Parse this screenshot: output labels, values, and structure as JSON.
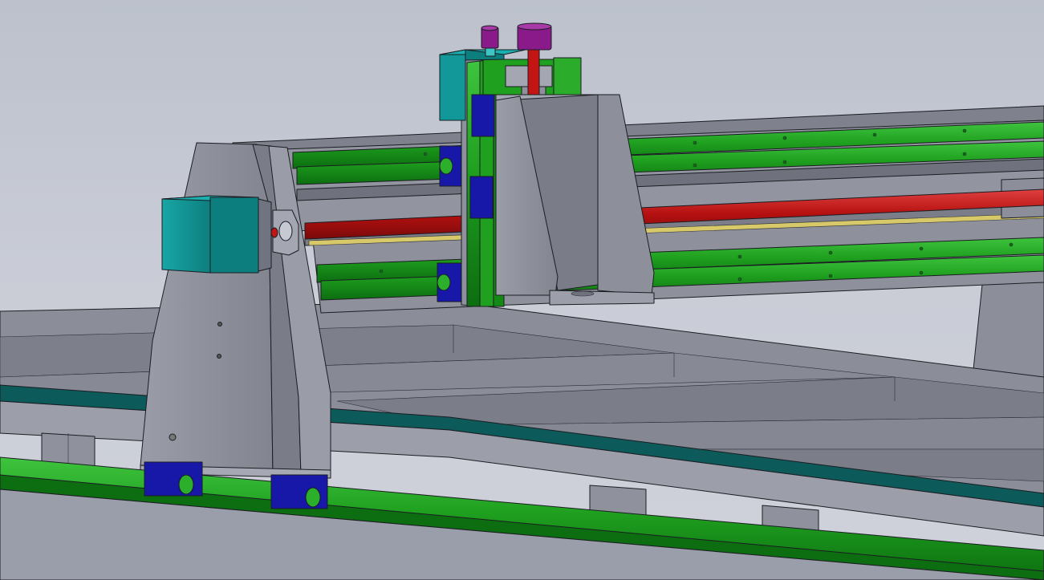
{
  "colors": {
    "background": "#c4c8d3",
    "frame_steel": "#8c8f9a",
    "frame_steel_dark": "#6f727c",
    "frame_steel_light": "#a9acb6",
    "linear_rail": "#1fa01f",
    "linear_rail_dark": "#0c6e10",
    "bearing_block": "#1717a8",
    "lead_screw": "#c41414",
    "stepper_motor": "#129898",
    "adjust_knob": "#8a1a8a",
    "table_edge": "#0d5a5a",
    "rack_strip": "#d7c86a"
  },
  "parts": [
    "table-frame",
    "y-axis-rail-left",
    "gantry-beam",
    "gantry-side-plate-left",
    "y-axis-stepper-motor",
    "x-axis-lead-screw",
    "x-axis-linear-rails",
    "z-axis-carriage",
    "z-axis-stepper-motor",
    "z-axis-adjust-knobs",
    "spindle-mount-bracket",
    "gantry-side-plate-right"
  ]
}
